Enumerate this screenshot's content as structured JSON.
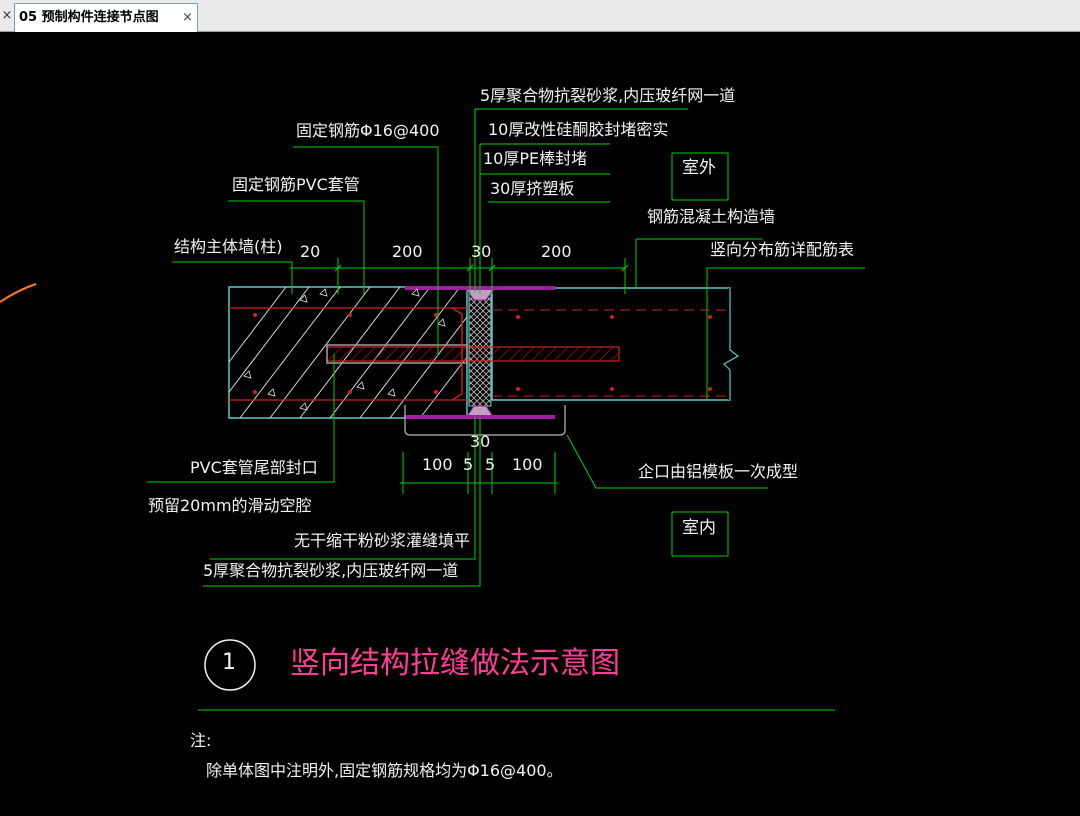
{
  "tabs": {
    "left_close": "×",
    "active_title": "05 预制构件连接节点图",
    "active_close": "×"
  },
  "drawing": {
    "callouts": {
      "top_mortar": "5厚聚合物抗裂砂浆,内压玻纤网一道",
      "sealant": "10厚改性硅酮胶封堵密实",
      "pe_rod": "10厚PE棒封堵",
      "xps_board": "30厚挤塑板",
      "fixed_rebar": "固定钢筋Φ16@400",
      "pvc_sleeve": "固定钢筋PVC套管",
      "main_wall": "结构主体墙(柱)",
      "rc_wall": "钢筋混凝土构造墙",
      "vertical_rebar": "竖向分布筋详配筋表",
      "pvc_tail_seal": "PVC套管尾部封口",
      "reserved_cavity": "预留20mm的滑动空腔",
      "notch": "企口由铝模板一次成型",
      "grout_fill": "无干缩干粉砂浆灌缝填平",
      "bottom_mortar": "5厚聚合物抗裂砂浆,内压玻纤网一道"
    },
    "zones": {
      "exterior": "室外",
      "interior": "室内"
    },
    "dimensions": {
      "top_20": "20",
      "top_200_left": "200",
      "top_30": "30",
      "top_200_right": "200",
      "bottom_30": "30",
      "bottom_100_left": "100",
      "bottom_5_left": "5",
      "bottom_5_right": "5",
      "bottom_100_right": "100"
    },
    "title": {
      "number": "1",
      "text": "竖向结构拉缝做法示意图"
    },
    "notes": {
      "heading": "注:",
      "line1": "除单体图中注明外,固定钢筋规格均为Φ16@400。"
    }
  },
  "colors": {
    "background": "#000000",
    "leader_green": "#00d000",
    "concrete_outline": "#5fc8c8",
    "rebar_red": "#d02020",
    "title_magenta": "#ff3c96",
    "sealant_magenta": "#a01ea0",
    "text": "#f2f2f2"
  }
}
